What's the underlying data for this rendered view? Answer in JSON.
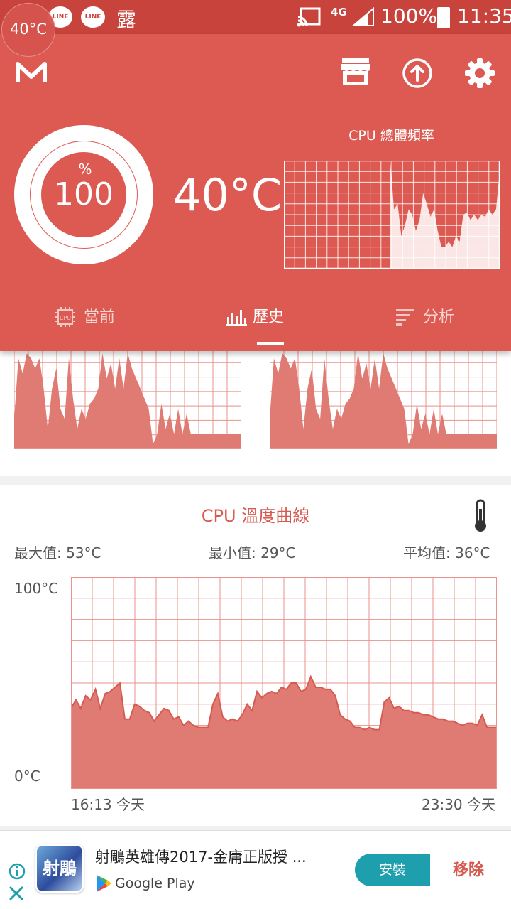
{
  "status_bar": {
    "temp_bubble": "40°C",
    "line1": "LINE",
    "line2": "LINE",
    "char": "露",
    "network": "4G",
    "battery": "100%",
    "time": "11:35"
  },
  "header": {
    "logo_icon": "m-logo-icon",
    "store_icon": "store-icon",
    "upload_icon": "upload-circle-icon",
    "settings_icon": "gear-icon",
    "usage_unit": "%",
    "usage_value": "100",
    "temperature": "40°C",
    "freq_chart_title": "CPU 總體頻率"
  },
  "tabs": [
    {
      "label": "當前",
      "icon": "cpu-chip-icon",
      "active": false
    },
    {
      "label": "歷史",
      "icon": "bar-chart-icon",
      "active": true
    },
    {
      "label": "分析",
      "icon": "list-lines-icon",
      "active": false
    }
  ],
  "temp_card": {
    "title": "CPU 溫度曲線",
    "icon": "thermometer-icon",
    "max": "最大值: 53°C",
    "min": "最小值: 29°C",
    "avg": "平均值: 36°C",
    "y_top": "100°C",
    "y_bottom": "0°C",
    "x_start": "16:13 今天",
    "x_end": "23:30 今天"
  },
  "chart_data": {
    "type": "area",
    "title": "CPU 溫度曲線",
    "ylabel": "",
    "ylim": [
      0,
      100
    ],
    "x_range": [
      "16:13 今天",
      "23:30 今天"
    ],
    "series": [
      {
        "values": [
          38,
          42,
          38,
          44,
          42,
          47,
          38,
          45,
          46,
          48,
          50,
          33,
          33,
          40,
          39,
          37,
          36,
          32,
          35,
          38,
          37,
          33,
          34,
          30,
          32,
          30,
          29,
          29,
          29,
          40,
          45,
          34,
          32,
          33,
          32,
          35,
          40,
          37,
          46,
          43,
          45,
          46,
          45,
          48,
          47,
          50,
          50,
          46,
          47,
          53,
          48,
          48,
          47,
          47,
          44,
          35,
          33,
          32,
          29,
          29,
          28,
          29,
          28,
          28,
          41,
          43,
          38,
          39,
          37,
          37,
          36,
          36,
          35,
          35,
          34,
          33,
          33,
          32,
          32,
          31,
          30,
          31,
          31,
          30,
          35,
          29,
          29,
          29
        ]
      }
    ],
    "grid": true
  },
  "ad": {
    "title": "射鵰英雄傳2017-金庸正版授 ...",
    "store": "Google Play",
    "install": "安裝",
    "remove": "移除",
    "info_icon": "info-icon",
    "close_icon": "close-icon",
    "app_icon": "game-app-icon",
    "app_icon_text": "射鵰"
  },
  "colors": {
    "primary": "#dc5a52",
    "status": "#c9433d",
    "chart_fill": "#e07b74",
    "accent_text": "#d65a50",
    "install": "#1e9fae"
  }
}
